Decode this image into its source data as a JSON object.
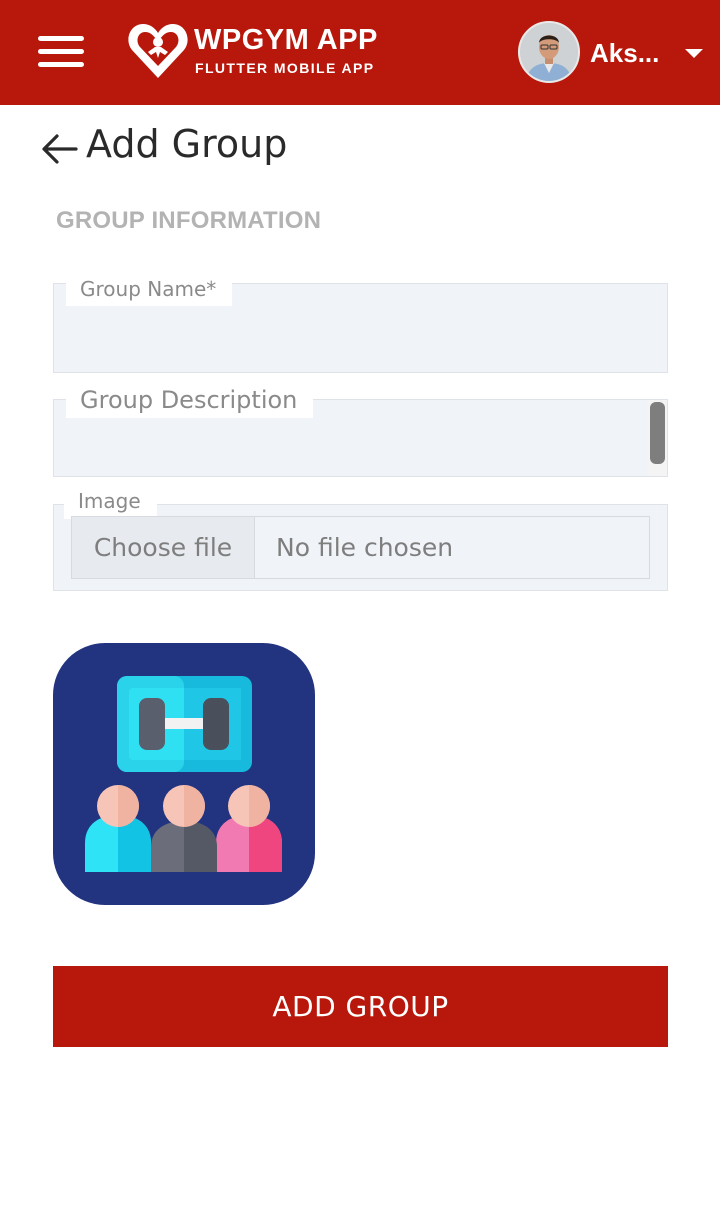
{
  "header": {
    "brand_title": "WPGYM APP",
    "brand_subtitle": "FLUTTER MOBILE APP",
    "user_name": "Aks...",
    "menu_icon": "hamburger-menu-icon",
    "dropdown_icon": "caret-down-icon",
    "colors": {
      "background": "#b8170c",
      "text": "#ffffff"
    }
  },
  "page": {
    "title": "Add Group",
    "back_icon": "arrow-left-icon",
    "section_title": "GROUP INFORMATION"
  },
  "form": {
    "group_name": {
      "label": "Group Name*",
      "value": ""
    },
    "group_description": {
      "label": "Group Description",
      "value": ""
    },
    "image": {
      "label": "Image",
      "button_label": "Choose file",
      "file_status": "No file chosen"
    },
    "preview_icon": "group-workout-icon",
    "submit_label": "ADD GROUP"
  },
  "colors": {
    "accent": "#b8170c",
    "field_background": "#f0f4f9",
    "section_label": "#b3b3b3"
  }
}
